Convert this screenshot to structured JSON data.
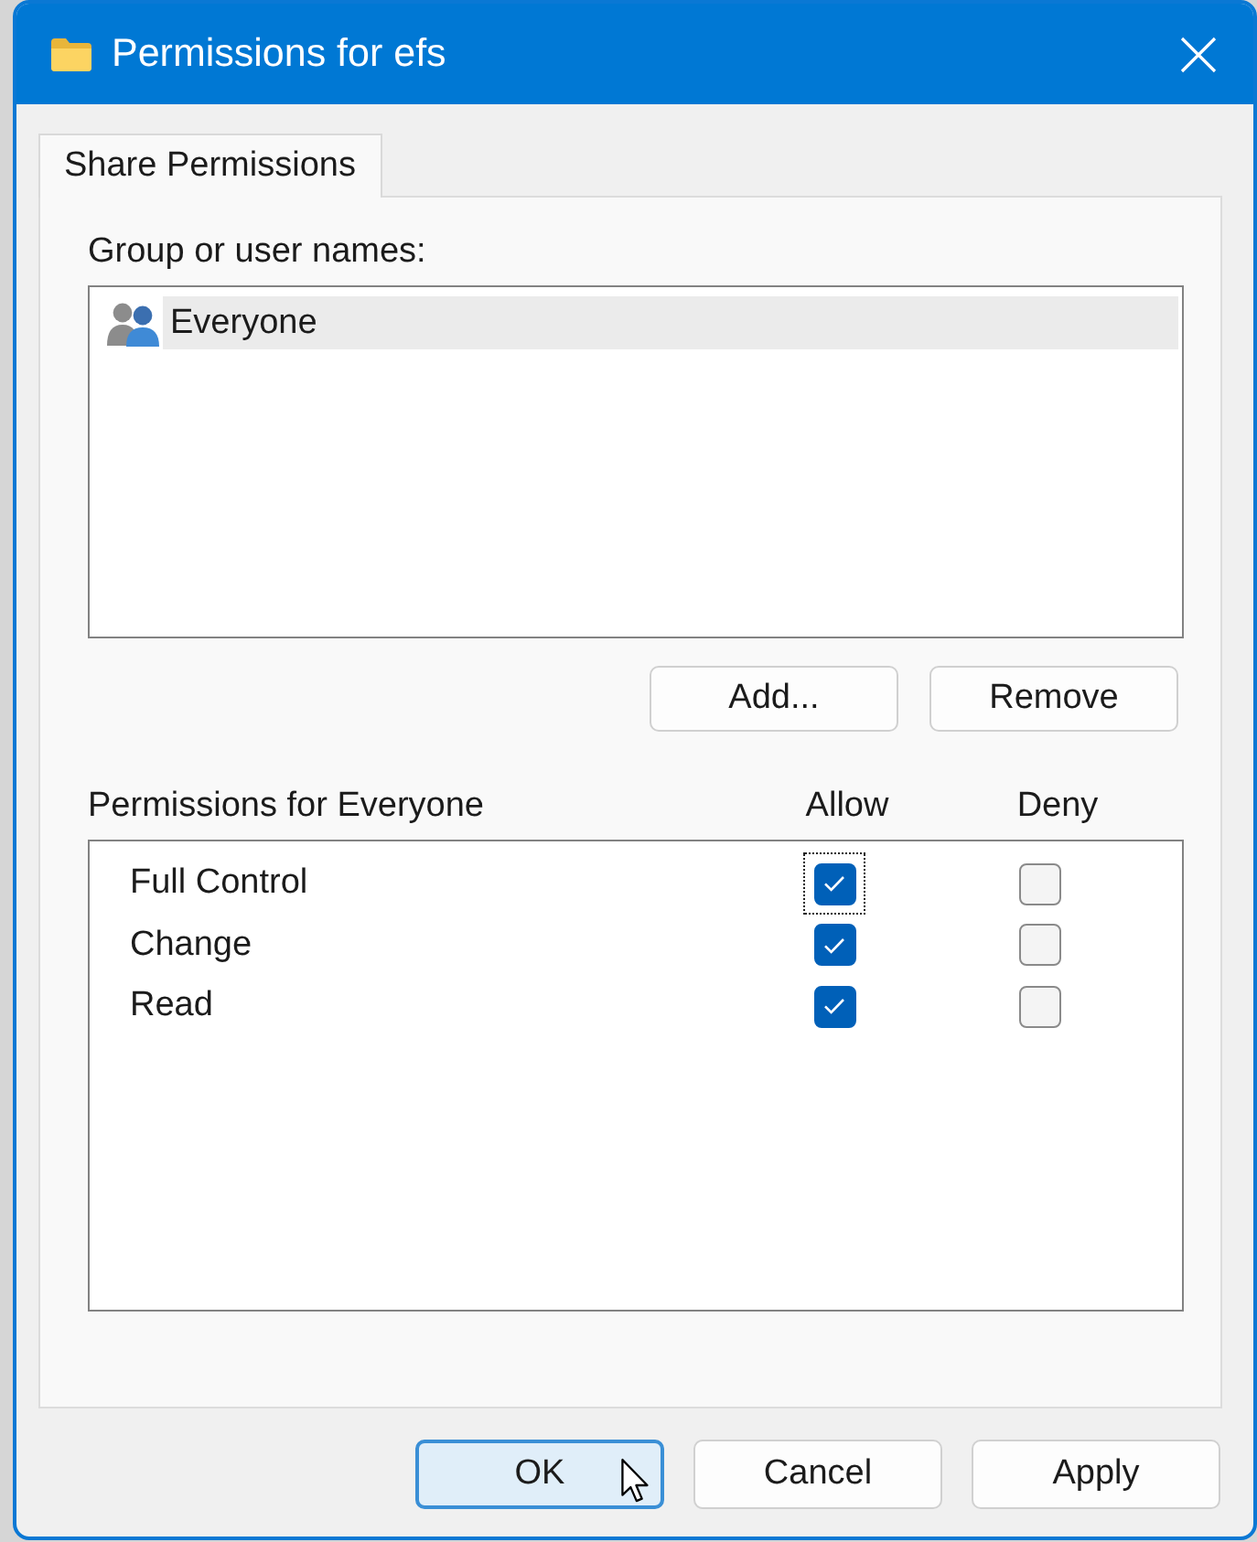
{
  "window": {
    "title": "Permissions for efs"
  },
  "tabs": [
    {
      "label": "Share Permissions",
      "selected": true
    }
  ],
  "groups": {
    "label": "Group or user names:",
    "items": [
      {
        "name": "Everyone",
        "selected": true
      }
    ],
    "buttons": [
      "Add...",
      "Remove"
    ]
  },
  "permissions": {
    "label": "Permissions for Everyone",
    "columns": [
      "Allow",
      "Deny"
    ],
    "rows": [
      {
        "name": "Full Control",
        "allow": true,
        "deny": false,
        "focused": true
      },
      {
        "name": "Change",
        "allow": true,
        "deny": false,
        "focused": false
      },
      {
        "name": "Read",
        "allow": true,
        "deny": false,
        "focused": false
      }
    ]
  },
  "buttons": [
    {
      "label": "OK",
      "default": true
    },
    {
      "label": "Cancel",
      "default": false
    },
    {
      "label": "Apply",
      "default": false
    }
  ]
}
